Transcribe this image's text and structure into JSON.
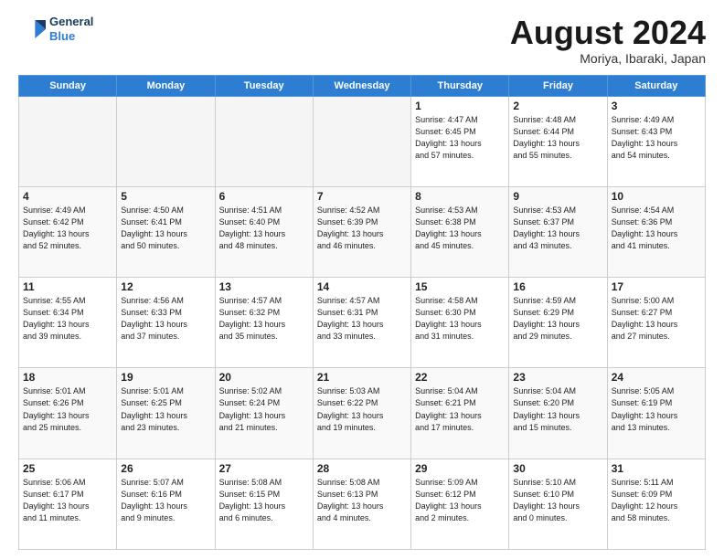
{
  "logo": {
    "line1": "General",
    "line2": "Blue"
  },
  "header": {
    "month": "August 2024",
    "location": "Moriya, Ibaraki, Japan"
  },
  "days_of_week": [
    "Sunday",
    "Monday",
    "Tuesday",
    "Wednesday",
    "Thursday",
    "Friday",
    "Saturday"
  ],
  "weeks": [
    [
      {
        "day": "",
        "info": ""
      },
      {
        "day": "",
        "info": ""
      },
      {
        "day": "",
        "info": ""
      },
      {
        "day": "",
        "info": ""
      },
      {
        "day": "1",
        "info": "Sunrise: 4:47 AM\nSunset: 6:45 PM\nDaylight: 13 hours\nand 57 minutes."
      },
      {
        "day": "2",
        "info": "Sunrise: 4:48 AM\nSunset: 6:44 PM\nDaylight: 13 hours\nand 55 minutes."
      },
      {
        "day": "3",
        "info": "Sunrise: 4:49 AM\nSunset: 6:43 PM\nDaylight: 13 hours\nand 54 minutes."
      }
    ],
    [
      {
        "day": "4",
        "info": "Sunrise: 4:49 AM\nSunset: 6:42 PM\nDaylight: 13 hours\nand 52 minutes."
      },
      {
        "day": "5",
        "info": "Sunrise: 4:50 AM\nSunset: 6:41 PM\nDaylight: 13 hours\nand 50 minutes."
      },
      {
        "day": "6",
        "info": "Sunrise: 4:51 AM\nSunset: 6:40 PM\nDaylight: 13 hours\nand 48 minutes."
      },
      {
        "day": "7",
        "info": "Sunrise: 4:52 AM\nSunset: 6:39 PM\nDaylight: 13 hours\nand 46 minutes."
      },
      {
        "day": "8",
        "info": "Sunrise: 4:53 AM\nSunset: 6:38 PM\nDaylight: 13 hours\nand 45 minutes."
      },
      {
        "day": "9",
        "info": "Sunrise: 4:53 AM\nSunset: 6:37 PM\nDaylight: 13 hours\nand 43 minutes."
      },
      {
        "day": "10",
        "info": "Sunrise: 4:54 AM\nSunset: 6:36 PM\nDaylight: 13 hours\nand 41 minutes."
      }
    ],
    [
      {
        "day": "11",
        "info": "Sunrise: 4:55 AM\nSunset: 6:34 PM\nDaylight: 13 hours\nand 39 minutes."
      },
      {
        "day": "12",
        "info": "Sunrise: 4:56 AM\nSunset: 6:33 PM\nDaylight: 13 hours\nand 37 minutes."
      },
      {
        "day": "13",
        "info": "Sunrise: 4:57 AM\nSunset: 6:32 PM\nDaylight: 13 hours\nand 35 minutes."
      },
      {
        "day": "14",
        "info": "Sunrise: 4:57 AM\nSunset: 6:31 PM\nDaylight: 13 hours\nand 33 minutes."
      },
      {
        "day": "15",
        "info": "Sunrise: 4:58 AM\nSunset: 6:30 PM\nDaylight: 13 hours\nand 31 minutes."
      },
      {
        "day": "16",
        "info": "Sunrise: 4:59 AM\nSunset: 6:29 PM\nDaylight: 13 hours\nand 29 minutes."
      },
      {
        "day": "17",
        "info": "Sunrise: 5:00 AM\nSunset: 6:27 PM\nDaylight: 13 hours\nand 27 minutes."
      }
    ],
    [
      {
        "day": "18",
        "info": "Sunrise: 5:01 AM\nSunset: 6:26 PM\nDaylight: 13 hours\nand 25 minutes."
      },
      {
        "day": "19",
        "info": "Sunrise: 5:01 AM\nSunset: 6:25 PM\nDaylight: 13 hours\nand 23 minutes."
      },
      {
        "day": "20",
        "info": "Sunrise: 5:02 AM\nSunset: 6:24 PM\nDaylight: 13 hours\nand 21 minutes."
      },
      {
        "day": "21",
        "info": "Sunrise: 5:03 AM\nSunset: 6:22 PM\nDaylight: 13 hours\nand 19 minutes."
      },
      {
        "day": "22",
        "info": "Sunrise: 5:04 AM\nSunset: 6:21 PM\nDaylight: 13 hours\nand 17 minutes."
      },
      {
        "day": "23",
        "info": "Sunrise: 5:04 AM\nSunset: 6:20 PM\nDaylight: 13 hours\nand 15 minutes."
      },
      {
        "day": "24",
        "info": "Sunrise: 5:05 AM\nSunset: 6:19 PM\nDaylight: 13 hours\nand 13 minutes."
      }
    ],
    [
      {
        "day": "25",
        "info": "Sunrise: 5:06 AM\nSunset: 6:17 PM\nDaylight: 13 hours\nand 11 minutes."
      },
      {
        "day": "26",
        "info": "Sunrise: 5:07 AM\nSunset: 6:16 PM\nDaylight: 13 hours\nand 9 minutes."
      },
      {
        "day": "27",
        "info": "Sunrise: 5:08 AM\nSunset: 6:15 PM\nDaylight: 13 hours\nand 6 minutes."
      },
      {
        "day": "28",
        "info": "Sunrise: 5:08 AM\nSunset: 6:13 PM\nDaylight: 13 hours\nand 4 minutes."
      },
      {
        "day": "29",
        "info": "Sunrise: 5:09 AM\nSunset: 6:12 PM\nDaylight: 13 hours\nand 2 minutes."
      },
      {
        "day": "30",
        "info": "Sunrise: 5:10 AM\nSunset: 6:10 PM\nDaylight: 13 hours\nand 0 minutes."
      },
      {
        "day": "31",
        "info": "Sunrise: 5:11 AM\nSunset: 6:09 PM\nDaylight: 12 hours\nand 58 minutes."
      }
    ]
  ]
}
